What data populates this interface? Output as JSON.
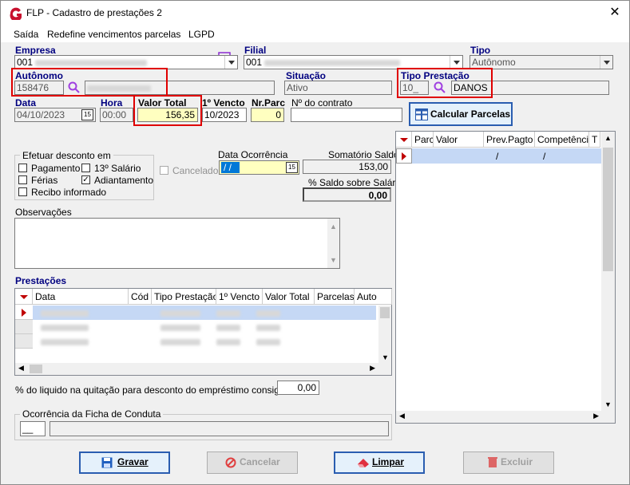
{
  "window": {
    "title": "FLP - Cadastro de prestações 2",
    "close": "✕"
  },
  "menu": {
    "items": [
      "Saída",
      "Redefine vencimentos parcelas",
      "LGPD"
    ]
  },
  "empresa": {
    "label": "Empresa",
    "value": "001"
  },
  "filial": {
    "label": "Filial",
    "value": "001"
  },
  "tipo": {
    "label": "Tipo",
    "value": "Autônomo"
  },
  "autonomo": {
    "label": "Autônomo",
    "value": "158476"
  },
  "situacao": {
    "label": "Situação",
    "value": "Ativo"
  },
  "tipo_prestacao": {
    "label": "Tipo Prestação",
    "code": "10_",
    "name": "DANOS"
  },
  "data": {
    "label": "Data",
    "value": "04/10/2023"
  },
  "hora": {
    "label": "Hora",
    "value": "00:00"
  },
  "valor_total": {
    "label": "Valor Total",
    "value": "156,35"
  },
  "primeiro_vencto": {
    "label": "1º Vencto",
    "value": "10/2023"
  },
  "nr_parc": {
    "label": "Nr.Parc",
    "value": "0"
  },
  "nr_contrato": {
    "label": "Nº do contrato",
    "value": ""
  },
  "calcular": {
    "label": "Calcular Parcelas"
  },
  "desconto": {
    "title": "Efetuar desconto em",
    "pagamento": "Pagamento",
    "decimo": "13º Salário",
    "ferias": "Férias",
    "adiantamento": "Adiantamento",
    "recibo": "Recibo informado"
  },
  "cancelado": {
    "label": "Cancelado"
  },
  "data_ocorrencia": {
    "label": "Data Ocorrência",
    "value": "/ /"
  },
  "saldo": {
    "label": "Somatório Saldo",
    "value": "153,00"
  },
  "perc_saldo": {
    "label": "% Saldo sobre Salário",
    "value": "0,00"
  },
  "observacoes": {
    "label": "Observações"
  },
  "prestacoes": {
    "label": "Prestações",
    "headers": [
      "Data",
      "Cód",
      "Tipo Prestação",
      "1º Vencto",
      "Valor Total",
      "Parcelas",
      "Auto"
    ]
  },
  "parcelas_grid": {
    "headers": [
      "Parc",
      "Valor",
      "Prev.Pagto",
      "Competência",
      "T"
    ],
    "row": {
      "prev": "/",
      "comp": "/"
    }
  },
  "perc_liquido": {
    "label": "% do liquido na quitação para desconto do empréstimo consignado",
    "value": "0,00"
  },
  "ocorrencia": {
    "title": "Ocorrência da Ficha de Conduta",
    "code": "__"
  },
  "buttons": {
    "gravar": "Gravar",
    "cancelar": "Cancelar",
    "limpar": "Limpar",
    "excluir": "Excluir"
  },
  "colors": {
    "label_blue": "#000080",
    "highlight": "#e00000",
    "calc_border": "#2a5db0"
  }
}
